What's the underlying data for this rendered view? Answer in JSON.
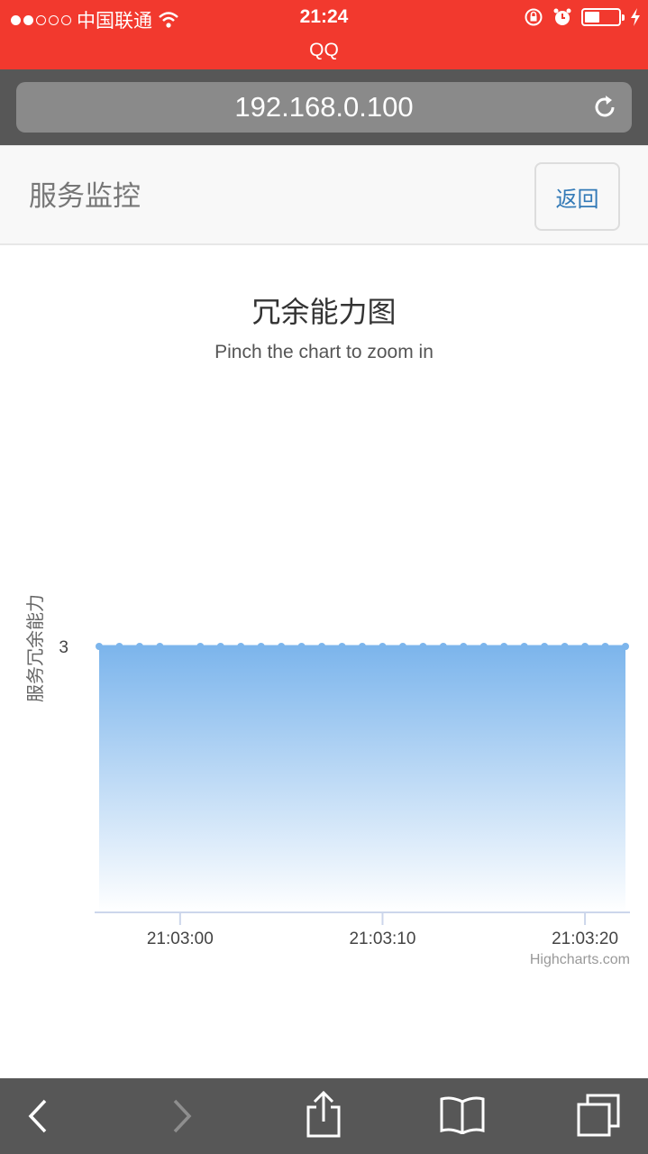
{
  "status_bar": {
    "carrier": "中国联通",
    "time": "21:24",
    "app_name": "QQ",
    "icons": [
      "signal-icon",
      "wifi-icon",
      "rotation-lock-icon",
      "alarm-icon",
      "battery-icon",
      "charging-icon"
    ]
  },
  "browser": {
    "url": "192.168.0.100",
    "reload_icon": "reload-icon"
  },
  "navbar": {
    "brand": "服务监控",
    "back_label": "返回"
  },
  "chart_data": {
    "type": "area",
    "title": "冗余能力图",
    "subtitle": "Pinch the chart to zoom in",
    "ylabel": "服务冗余能力",
    "xlabel": "",
    "y_ticks": [
      "3"
    ],
    "x_ticks": [
      "21:03:00",
      "21:03:10",
      "21:03:20"
    ],
    "x_tick_seconds": [
      0,
      10,
      20
    ],
    "x": [
      -4,
      -3,
      -2,
      -1,
      1,
      2,
      3,
      4,
      5,
      6,
      7,
      8,
      9,
      10,
      11,
      12,
      13,
      14,
      15,
      16,
      17,
      18,
      19,
      20,
      21,
      22
    ],
    "values": [
      3,
      3,
      3,
      3,
      3,
      3,
      3,
      3,
      3,
      3,
      3,
      3,
      3,
      3,
      3,
      3,
      3,
      3,
      3,
      3,
      3,
      3,
      3,
      3,
      3,
      3
    ],
    "xlim": [
      -4,
      22
    ],
    "credits": "Highcharts.com",
    "series_color": "#7cb5ec"
  },
  "toolbar": {
    "icons": [
      "back-arrow-icon",
      "forward-arrow-icon",
      "share-icon",
      "bookmarks-icon",
      "tabs-icon"
    ]
  }
}
